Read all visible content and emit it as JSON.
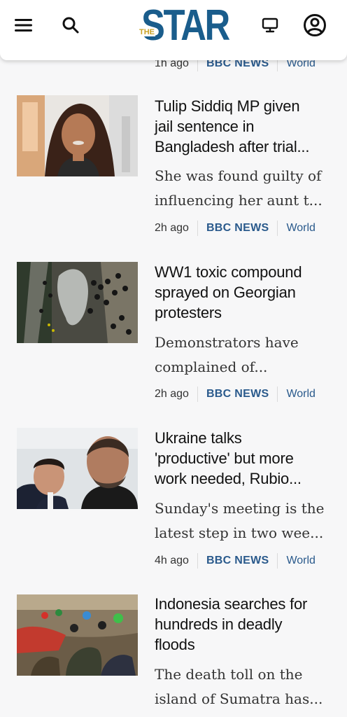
{
  "header": {
    "logo_main": "STAR",
    "logo_prefix": "THE",
    "brand_color": "#1a5d8c",
    "prefix_color": "#c9a227"
  },
  "partial_row": {
    "time": "1h ago",
    "source": "BBC NEWS",
    "category": "World"
  },
  "articles": [
    {
      "title_lines": [
        "Tulip Siddiq MP given",
        "jail sentence in",
        "Bangladesh after trial..."
      ],
      "summary_lines": [
        "She was found guilty of",
        "influencing her aunt t..."
      ],
      "time": "2h ago",
      "source": "BBC NEWS",
      "category": "World"
    },
    {
      "title_lines": [
        "WW1 toxic compound",
        "sprayed on Georgian",
        "protesters"
      ],
      "summary_lines": [
        "Demonstrators have",
        "complained of..."
      ],
      "time": "2h ago",
      "source": "BBC NEWS",
      "category": "World"
    },
    {
      "title_lines": [
        "Ukraine talks",
        "'productive' but more",
        "work needed, Rubio..."
      ],
      "summary_lines": [
        "Sunday's meeting is the",
        "latest step in two wee..."
      ],
      "time": "4h ago",
      "source": "BBC NEWS",
      "category": "World"
    },
    {
      "title_lines": [
        "Indonesia searches for",
        "hundreds in deadly",
        "floods"
      ],
      "summary_lines": [
        "The death toll on the",
        "island of Sumatra has..."
      ]
    }
  ]
}
